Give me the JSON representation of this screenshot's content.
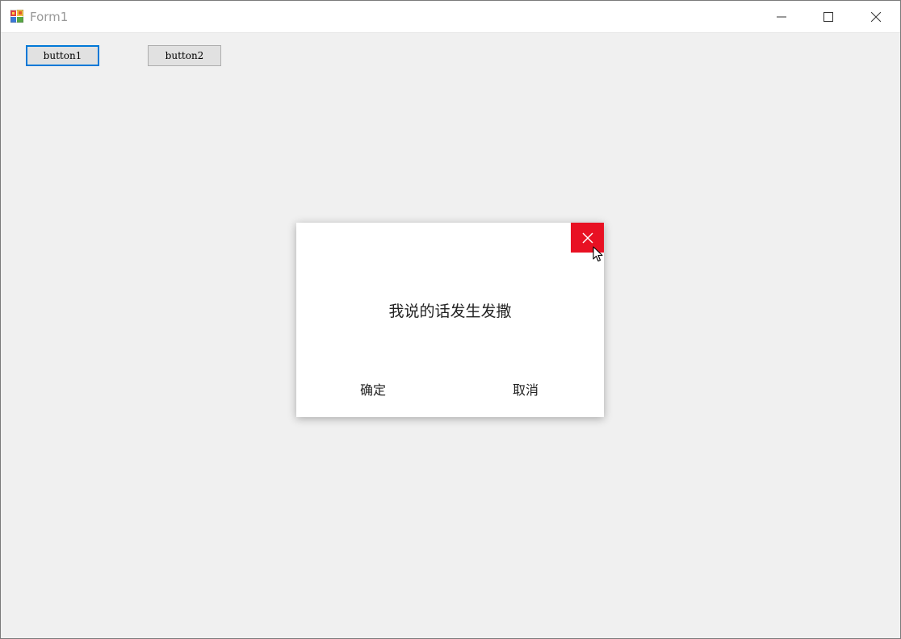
{
  "window": {
    "title": "Form1",
    "app_icon": "winforms-app-icon",
    "caption_buttons": [
      "minimize-icon",
      "maximize-icon",
      "close-icon"
    ]
  },
  "form": {
    "button1_label": "button1",
    "button2_label": "button2",
    "focused_button": "button1"
  },
  "dialog": {
    "message": "我说的话发生发撒",
    "ok_label": "确定",
    "cancel_label": "取消",
    "close_icon": "close-icon",
    "close_hover_color": "#e81123"
  },
  "colors": {
    "form_background": "#f0f0f0",
    "focus_border": "#0078d7"
  }
}
